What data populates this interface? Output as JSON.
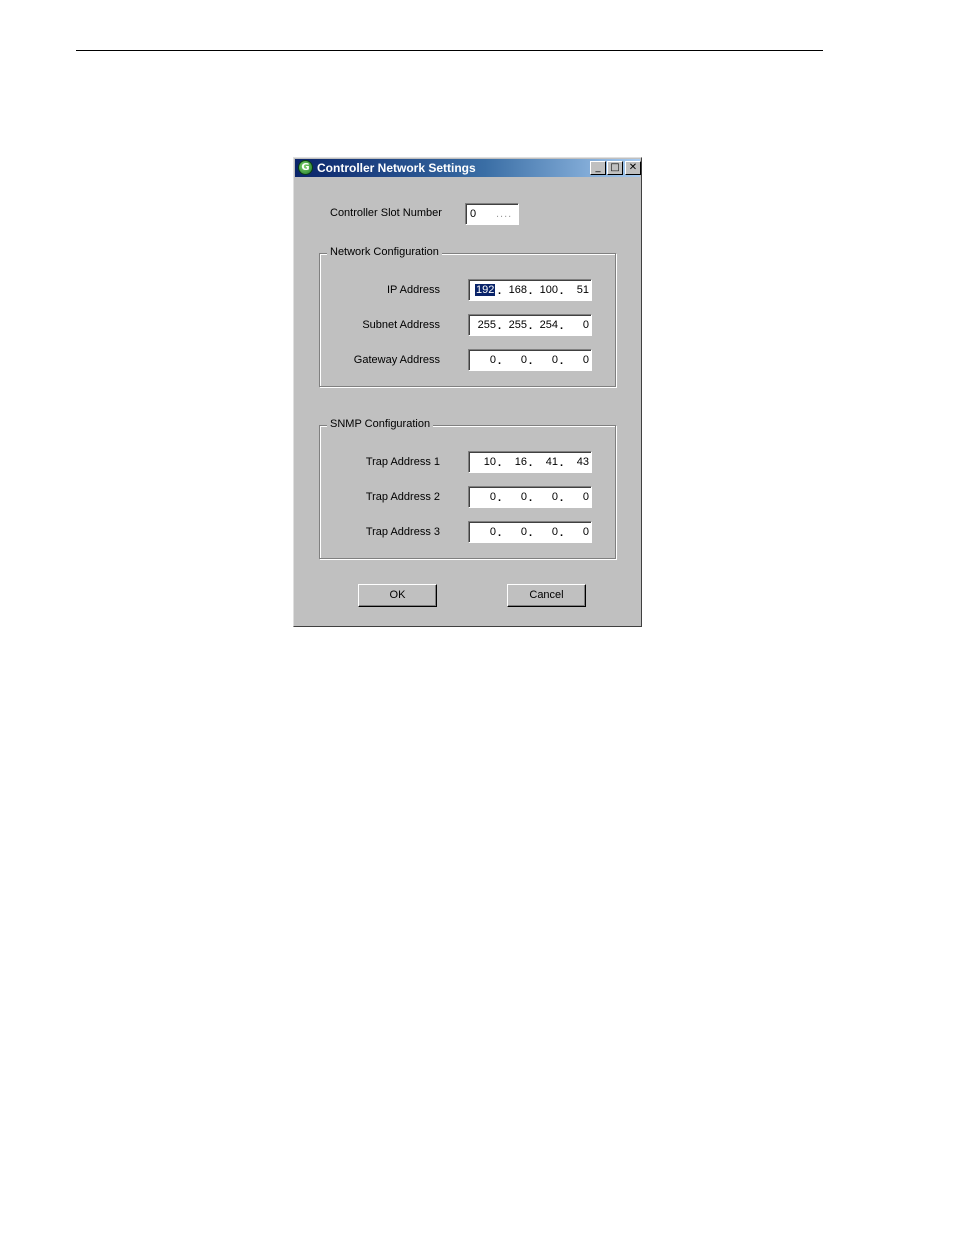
{
  "window": {
    "title": "Controller Network Settings",
    "icon": "grass-valley-g-icon",
    "minimize_glyph": "_",
    "maximize_glyph": "□",
    "close_glyph": "✕"
  },
  "slot": {
    "label": "Controller Slot Number",
    "value": "0",
    "trailing": "...."
  },
  "network": {
    "title": "Network Configuration",
    "ip": {
      "label": "IP Address",
      "octets": [
        "192",
        "168",
        "100",
        "51"
      ],
      "selected_octet": 0
    },
    "subnet": {
      "label": "Subnet Address",
      "octets": [
        "255",
        "255",
        "254",
        "0"
      ]
    },
    "gateway": {
      "label": "Gateway Address",
      "octets": [
        "0",
        "0",
        "0",
        "0"
      ]
    }
  },
  "snmp": {
    "title": "SNMP Configuration",
    "trap1": {
      "label": "Trap Address 1",
      "octets": [
        "10",
        "16",
        "41",
        "43"
      ]
    },
    "trap2": {
      "label": "Trap Address 2",
      "octets": [
        "0",
        "0",
        "0",
        "0"
      ]
    },
    "trap3": {
      "label": "Trap Address 3",
      "octets": [
        "0",
        "0",
        "0",
        "0"
      ]
    }
  },
  "buttons": {
    "ok": "OK",
    "cancel": "Cancel"
  },
  "colors": {
    "title_bar": "#0a246a",
    "dialog_bg": "#c0c0c0",
    "selection": "#0a246a"
  },
  "dot_char": "."
}
